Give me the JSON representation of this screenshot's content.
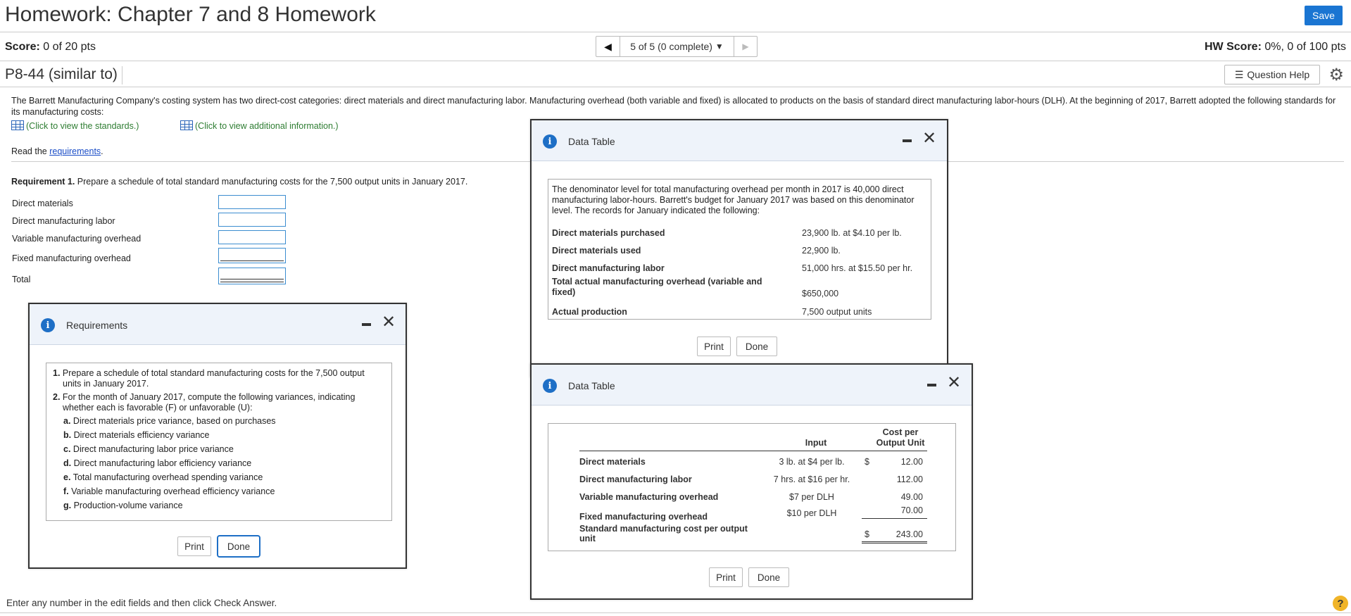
{
  "header": {
    "title": "Homework: Chapter 7 and 8 Homework",
    "save_label": "Save"
  },
  "scorebar": {
    "score_label": "Score:",
    "score_value": "0 of 20 pts",
    "nav_label": "5 of 5 (0 complete)",
    "hw_score_label": "HW Score:",
    "hw_score_value": "0%, 0 of 100 pts"
  },
  "question": {
    "id": "P8-44 (similar to)",
    "help_label": "Question Help"
  },
  "problem": {
    "intro": "The Barrett Manufacturing Company's costing system has two direct-cost categories: direct materials and direct manufacturing labor. Manufacturing overhead (both variable and fixed) is allocated to products on the basis of standard direct manufacturing labor-hours (DLH). At the beginning of 2017, Barrett adopted the following standards for its manufacturing costs:",
    "link_standards": "(Click to view the standards.)",
    "link_additional": "(Click to view additional information.)",
    "read_prefix": "Read the ",
    "read_link": "requirements",
    "read_suffix": "."
  },
  "requirement1": {
    "label": "Requirement 1.",
    "text": " Prepare a schedule of total standard manufacturing costs for the 7,500 output units in January 2017.",
    "rows": [
      "Direct materials",
      "Direct manufacturing labor",
      "Variable manufacturing overhead",
      "Fixed manufacturing overhead",
      "Total"
    ]
  },
  "footer": {
    "hint": "Enter any number in the edit fields and then click Check Answer.",
    "help": "?"
  },
  "requirements_dialog": {
    "title": "Requirements",
    "item1_num": "1.",
    "item1": "Prepare a schedule of total standard manufacturing costs for the 7,500 output units in January 2017.",
    "item2_num": "2.",
    "item2": "For the month of January 2017, compute the following variances, indicating whether each is favorable (F) or unfavorable (U):",
    "subs": [
      {
        "letter": "a.",
        "text": "Direct materials price variance, based on purchases"
      },
      {
        "letter": "b.",
        "text": "Direct materials efficiency variance"
      },
      {
        "letter": "c.",
        "text": "Direct manufacturing labor price variance"
      },
      {
        "letter": "d.",
        "text": "Direct manufacturing labor efficiency variance"
      },
      {
        "letter": "e.",
        "text": "Total manufacturing overhead spending variance"
      },
      {
        "letter": "f.",
        "text": "Variable manufacturing overhead efficiency variance"
      },
      {
        "letter": "g.",
        "text": "Production-volume variance"
      }
    ],
    "print_label": "Print",
    "done_label": "Done"
  },
  "additional_dialog": {
    "title": "Data Table",
    "intro": "The denominator level for total manufacturing overhead per month in 2017 is 40,000 direct manufacturing labor-hours. Barrett's budget for January 2017 was based on this denominator level. The records for January indicated the following:",
    "rows": [
      {
        "label": "Direct materials purchased",
        "value": "23,900 lb. at $4.10 per lb."
      },
      {
        "label": "Direct materials used",
        "value": "22,900 lb."
      },
      {
        "label": "Direct manufacturing labor",
        "value": "51,000 hrs. at $15.50 per hr."
      },
      {
        "label": "Total actual manufacturing overhead (variable and fixed)",
        "value": "$650,000"
      },
      {
        "label": "Actual production",
        "value": "7,500 output units"
      }
    ],
    "print_label": "Print",
    "done_label": "Done"
  },
  "standards_dialog": {
    "title": "Data Table",
    "col_input": "Input",
    "col_cost": "Cost per Output Unit",
    "rows": [
      {
        "label": "Direct materials",
        "input": "3 lb. at $4 per lb.",
        "currency": "$",
        "amount": "12.00"
      },
      {
        "label": "Direct manufacturing labor",
        "input": "7 hrs. at $16 per hr.",
        "currency": "",
        "amount": "112.00"
      },
      {
        "label": "Variable manufacturing overhead",
        "input": "$7 per DLH",
        "currency": "",
        "amount": "49.00"
      },
      {
        "label": "Fixed manufacturing overhead",
        "input": "$10 per DLH",
        "currency": "",
        "amount": "70.00"
      },
      {
        "label": "Standard manufacturing cost per output unit",
        "input": "",
        "currency": "$",
        "amount": "243.00"
      }
    ],
    "print_label": "Print",
    "done_label": "Done"
  }
}
